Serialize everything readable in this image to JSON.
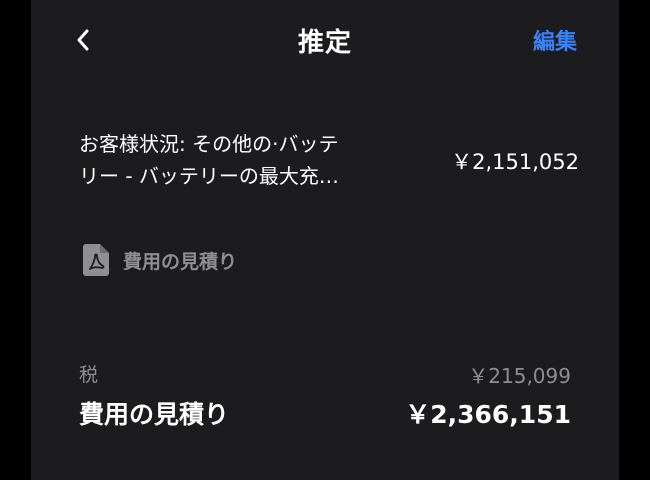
{
  "header": {
    "title": "推定",
    "edit_label": "編集",
    "back_icon": "chevron-left-icon"
  },
  "line_item": {
    "description_line1": "お客様状況: その他の·バッテ",
    "description_line2": "リー - バッテリーの最大充…",
    "amount": "￥2,151,052"
  },
  "attachment": {
    "icon": "pdf-document-icon",
    "label": "費用の見積り"
  },
  "summary": {
    "tax_label": "税",
    "tax_amount": "￥215,099",
    "total_label": "費用の見積り",
    "total_amount": "￥2,366,151"
  },
  "colors": {
    "background": "#000000",
    "panel": "#1c1c1e",
    "accent": "#3b82f6",
    "secondary_text": "#8e8e93"
  }
}
